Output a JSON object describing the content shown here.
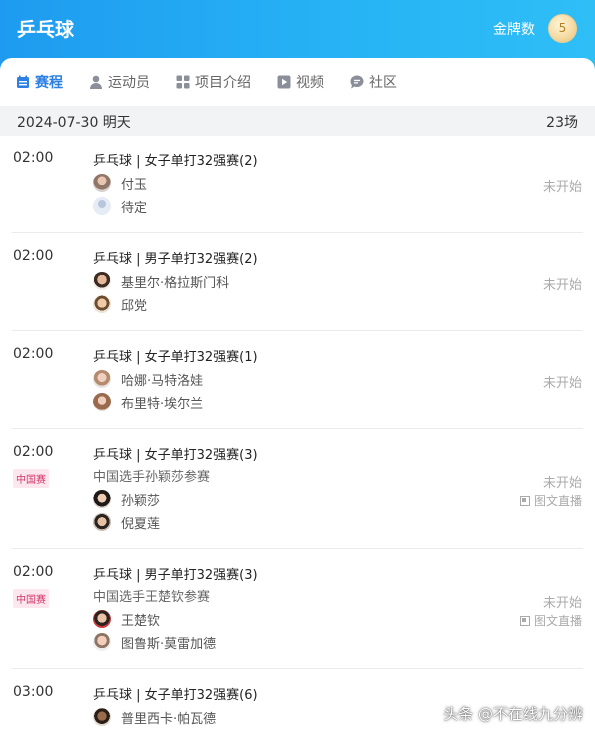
{
  "header": {
    "title": "乒乓球",
    "medal_label": "金牌数",
    "medal_count": "5"
  },
  "tabs": [
    {
      "label": "赛程",
      "icon": "calendar-icon",
      "active": true
    },
    {
      "label": "运动员",
      "icon": "person-icon"
    },
    {
      "label": "项目介绍",
      "icon": "grid-icon"
    },
    {
      "label": "视频",
      "icon": "play-icon"
    },
    {
      "label": "社区",
      "icon": "chat-icon"
    }
  ],
  "datebar": {
    "date": "2024-07-30 明天",
    "count": "23场"
  },
  "matches": [
    {
      "time": "02:00",
      "event": "乒乓球 | 女子单打32强赛(2)",
      "players": [
        "付玉",
        "待定"
      ],
      "status": "未开始"
    },
    {
      "time": "02:00",
      "event": "乒乓球 | 男子单打32强赛(2)",
      "players": [
        "基里尔·格拉斯门科",
        "邱党"
      ],
      "status": "未开始"
    },
    {
      "time": "02:00",
      "event": "乒乓球 | 女子单打32强赛(1)",
      "players": [
        "哈娜·马特洛娃",
        "布里特·埃尔兰"
      ],
      "status": "未开始"
    },
    {
      "time": "02:00",
      "badge": "中国赛",
      "event": "乒乓球 | 女子单打32强赛(3)",
      "note": "中国选手孙颖莎参赛",
      "players": [
        "孙颖莎",
        "倪夏莲"
      ],
      "status": "未开始",
      "live": "图文直播"
    },
    {
      "time": "02:00",
      "badge": "中国赛",
      "event": "乒乓球 | 男子单打32强赛(3)",
      "note": "中国选手王楚钦参赛",
      "players": [
        "王楚钦",
        "图鲁斯·莫雷加德"
      ],
      "status": "未开始",
      "live": "图文直播"
    },
    {
      "time": "03:00",
      "event": "乒乓球 | 女子单打32强赛(6)",
      "players": [
        "普里西卡·帕瓦德"
      ]
    }
  ],
  "watermark": "头条 @不在线九分辨"
}
